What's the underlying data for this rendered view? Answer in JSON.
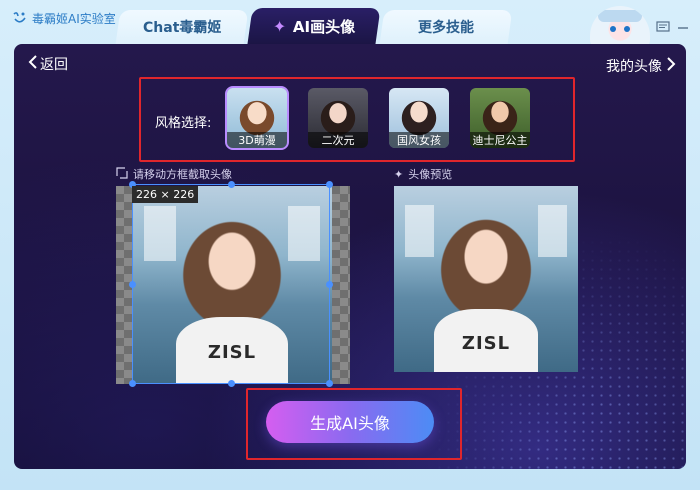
{
  "app": {
    "title": "毒霸姬AI实验室"
  },
  "tabs": [
    {
      "label": "Chat毒霸姬",
      "active": false
    },
    {
      "label": "AI画头像",
      "active": true
    },
    {
      "label": "更多技能",
      "active": false
    }
  ],
  "nav": {
    "back_label": "返回",
    "my_avatar_label": "我的头像"
  },
  "style_select": {
    "label": "风格选择:",
    "items": [
      {
        "label": "3D萌漫",
        "selected": true
      },
      {
        "label": "二次元",
        "selected": false
      },
      {
        "label": "国风女孩",
        "selected": false
      },
      {
        "label": "迪士尼公主",
        "selected": false
      }
    ]
  },
  "crop": {
    "hint": "请移动方框截取头像",
    "size_label": "226 × 226"
  },
  "preview": {
    "hint": "头像预览",
    "shirt_text": "ZISL"
  },
  "generate": {
    "label": "生成AI头像"
  },
  "colors": {
    "accent": "#e0262c",
    "panel": "#1c1340",
    "button_start": "#d55ef0",
    "button_end": "#4c8cf5"
  }
}
